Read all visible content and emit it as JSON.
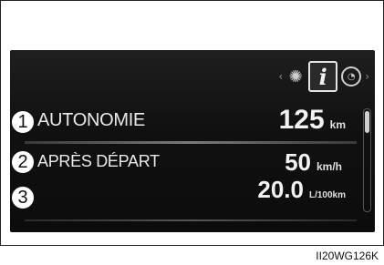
{
  "icons": {
    "left_arrow": "‹",
    "settings": "gear-icon",
    "info_letter": "i",
    "gauge": "gauge-icon",
    "right_arrow": "›"
  },
  "rows": [
    {
      "callout": "1",
      "label": "AUTONOMIE",
      "value": "125",
      "unit": "km"
    },
    {
      "callout": "2",
      "label": "APRÈS DÉPART",
      "value": "50",
      "unit": "km/h"
    },
    {
      "callout": "3",
      "label": "",
      "value": "20.0",
      "unit": "L/100km"
    }
  ],
  "figure_code": "II20WG126K",
  "colors": {
    "screen_bg": "#111111",
    "text": "#e9e9e9",
    "callout_border": "#111111"
  }
}
